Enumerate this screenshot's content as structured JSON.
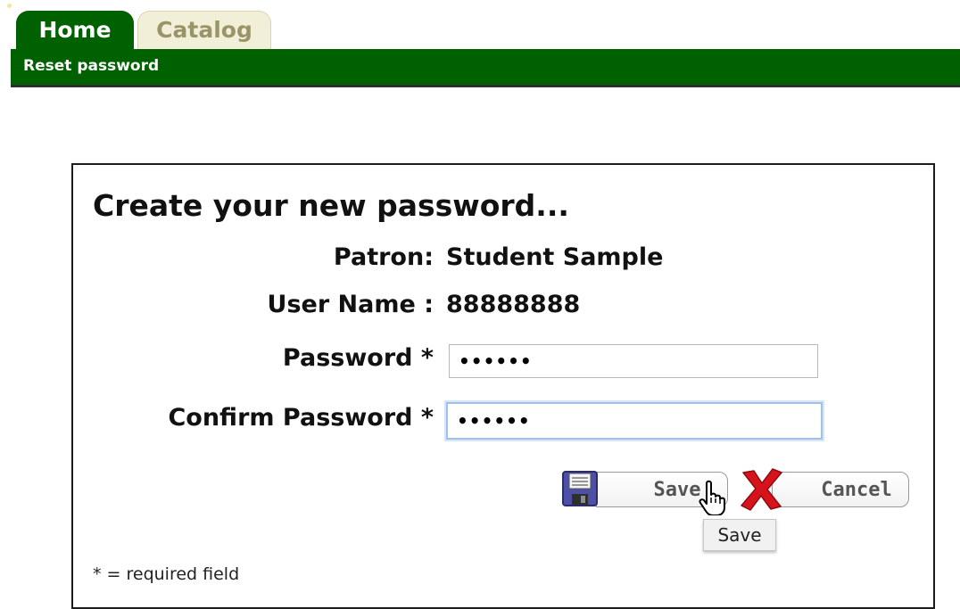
{
  "tabs": [
    {
      "label": "Home",
      "active": true
    },
    {
      "label": "Catalog",
      "active": false
    }
  ],
  "menubar": {
    "label": "Reset password"
  },
  "form": {
    "heading": "Create your new password...",
    "patron_label": "Patron:",
    "patron_value": "Student Sample",
    "username_label": "User Name :",
    "username_value": "88888888",
    "password_label": "Password *",
    "password_value": "••••••",
    "confirm_label": "Confirm Password *",
    "confirm_value": "••••••",
    "save_label": "Save",
    "cancel_label": "Cancel",
    "tooltip": "Save",
    "required_note": "* = required field"
  },
  "icons": {
    "save": "floppy-disk-icon",
    "cancel": "red-x-icon",
    "cursor": "hand-pointer-icon"
  },
  "colors": {
    "brand_green": "#006100",
    "cancel_red": "#d6131b",
    "focus_ring": "#9ec2ec"
  }
}
